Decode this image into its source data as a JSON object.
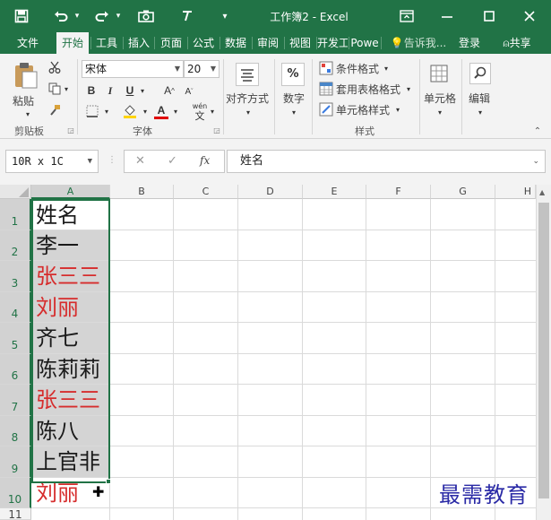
{
  "title_bar": {
    "title": "工作簿2 - Excel",
    "save_glyph": "🖫",
    "undo_glyph": "↶",
    "redo_glyph": "↷",
    "camera_glyph": "📷",
    "customize_glyph": "▾",
    "ribbon_display_glyph": "🗖",
    "minimize_glyph": "—",
    "maximize_glyph": "☐",
    "close_glyph": "✕"
  },
  "tabs": [
    {
      "label": "文件"
    },
    {
      "label": "开始"
    },
    {
      "label": "工具"
    },
    {
      "label": "插入"
    },
    {
      "label": "页面"
    },
    {
      "label": "公式"
    },
    {
      "label": "数据"
    },
    {
      "label": "审阅"
    },
    {
      "label": "视图"
    },
    {
      "label": "开发工"
    },
    {
      "label": "Powe"
    }
  ],
  "tell_me": "告诉我...",
  "sign_in": "登录",
  "share": "共享",
  "ribbon": {
    "clipboard": {
      "paste_label": "粘贴",
      "group_label": "剪贴板"
    },
    "font": {
      "font_name": "宋体",
      "font_size": "20",
      "bold": "B",
      "italic": "I",
      "underline": "U",
      "grow": "A",
      "shrink": "A",
      "wen": "wén",
      "wen_char": "文",
      "font_color_letter": "A",
      "group_label": "字体"
    },
    "alignment": {
      "label": "对齐方式"
    },
    "number": {
      "label": "数字",
      "icon_text": "%"
    },
    "styles": {
      "conditional_format": "条件格式",
      "format_as_table": "套用表格格式",
      "cell_styles": "单元格样式",
      "group_label": "样式"
    },
    "cells": {
      "label": "单元格"
    },
    "editing": {
      "label": "编辑"
    }
  },
  "formula_bar": {
    "name_box": "10R x 1C",
    "cancel_glyph": "✕",
    "enter_glyph": "✓",
    "fx_label": "fx",
    "content": "姓名"
  },
  "grid": {
    "columns": [
      "A",
      "B",
      "C",
      "D",
      "E",
      "F",
      "G",
      "H"
    ],
    "rows": [
      "1",
      "2",
      "3",
      "4",
      "5",
      "6",
      "7",
      "8",
      "9",
      "10",
      "11"
    ],
    "column_a": [
      {
        "text": "姓名",
        "color": "black"
      },
      {
        "text": "李一",
        "color": "black"
      },
      {
        "text": "张三三",
        "color": "red"
      },
      {
        "text": "刘丽",
        "color": "red"
      },
      {
        "text": "齐七",
        "color": "black"
      },
      {
        "text": "陈莉莉",
        "color": "black"
      },
      {
        "text": "张三三",
        "color": "red"
      },
      {
        "text": "陈八",
        "color": "black"
      },
      {
        "text": "上官非",
        "color": "black"
      },
      {
        "text": "刘丽",
        "color": "red"
      }
    ]
  },
  "watermark": "最需教育",
  "colors": {
    "excel_green": "#217346",
    "red_text": "#d62d2d",
    "selection_fill": "#d4d4d4"
  }
}
